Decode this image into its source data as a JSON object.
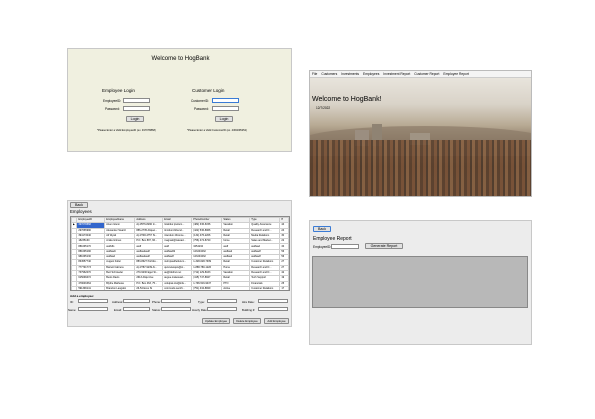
{
  "login": {
    "title": "Welcome to HogBank",
    "employee": {
      "heading": "Employee Login",
      "id_label": "EmployeeID:",
      "password_label": "Password:",
      "button": "Login",
      "hint": "*Please Enter a Valid EmployeeID (ex. 497078868)"
    },
    "customer": {
      "heading": "Customer Login",
      "id_label": "CustomerID:",
      "password_label": "Password:",
      "button": "Login",
      "hint": "*Please Enter a Valid CustomerID (ex. 4364095252)"
    }
  },
  "main": {
    "menu": [
      "File",
      "Customers",
      "Investments",
      "Employees",
      "Investment Report",
      "Customer Report",
      "Employee Report"
    ],
    "welcome": "Welcome to HogBank!",
    "date": "12/7/2022"
  },
  "employees": {
    "back": "Back",
    "title": "Employees",
    "columns": [
      "",
      "EmployeeID",
      "EmployeeName",
      "Address",
      "Email",
      "PhoneNumber",
      "Status",
      "Type",
      "H"
    ],
    "rows": [
      [
        "▶",
        "497078868",
        "Aiven Glenn",
        "Ap #576-8290 In...",
        "lorabitur.pretium...",
        "(482) 336-6156",
        "Vacation",
        "Quality Assurance",
        "44"
      ],
      [
        "",
        "297665990",
        "Alexander Swartz",
        "886-2735 Aliquet...",
        "tincidunt.bibend...",
        "(422) 536-8966",
        "Retail",
        "Research and D...",
        "24"
      ],
      [
        "",
        "394173040",
        "Ali Wyatt",
        "Ap #748-4757 Si...",
        "interdum.libronce...",
        "(132) 476-2206",
        "Retail",
        "Media Relations",
        "30"
      ],
      [
        "",
        "18235160",
        "Anika Grimes",
        "P.O. Box 897, 66...",
        "magnad@natoad...",
        "(756) 474-8720",
        "home",
        "Sales and Market...",
        "22"
      ],
      [
        "",
        "881695170",
        "asdfdfs",
        "asdf",
        "asdf",
        "3454234",
        "asdf",
        "asdfasd",
        "34"
      ],
      [
        "",
        "881695190",
        "asdfasdt",
        "asdfasdasdf",
        "asdfasdfd",
        "123243432",
        "asdfasd",
        "asdfasdf",
        "56"
      ],
      [
        "",
        "981695130",
        "asdfasd",
        "asdfasdasdf",
        "asdfasdf",
        "123243432",
        "asdfasd",
        "asdfasdf",
        "56"
      ],
      [
        "",
        "864557740",
        "August Fuller",
        "883-8627 Porttito...",
        "nulmpasdfeiferum...",
        "1-328-628-7939",
        "Retail",
        "Customer Relations",
        "27"
      ],
      [
        "",
        "777791773",
        "Barrett Cabrera",
        "Ap #787-9239 Ar...",
        "quis.leleiquis@st...",
        "1-888-780-1226",
        "Home",
        "Research and D...",
        "27"
      ],
      [
        "",
        "737962070",
        "Bert Schroeder",
        "270-9230 Eget St...",
        "au@tiluthur.net",
        "(712) 129-8163",
        "Vacation",
        "Research and D...",
        "42"
      ],
      [
        "",
        "615099472",
        "Bevis Davis",
        "2613 Aliqui Ave",
        "augue.malesuad...",
        "(415) 747-8927",
        "Retail",
        "Tech Support",
        "19"
      ],
      [
        "",
        "479046364",
        "Blythe Mathews",
        "P.O. Box 463, 75...",
        "volutpat.nisi@infe...",
        "1-796-516-9437",
        "PTO",
        "Financials",
        "25"
      ],
      [
        "",
        "591399141",
        "Brandon Langdon",
        "26-54 Ecus St",
        "commodo.semifi...",
        "(751) 434-8829",
        "Active",
        "Customer Relations",
        "17"
      ]
    ],
    "add_label": "Add a employee:",
    "fields": [
      "ID:",
      "Address:",
      "Phone:",
      "Type:",
      "Hire Date:",
      "Name:",
      "Email:",
      "Status:",
      "Hourly Rate:",
      "Building #:"
    ],
    "buttons": [
      "Update Employee",
      "Delete Employee",
      "Add Employee"
    ]
  },
  "report": {
    "back": "Back",
    "title": "Employee Report",
    "id_label": "EmployeeID:",
    "button": "Generate Report"
  }
}
